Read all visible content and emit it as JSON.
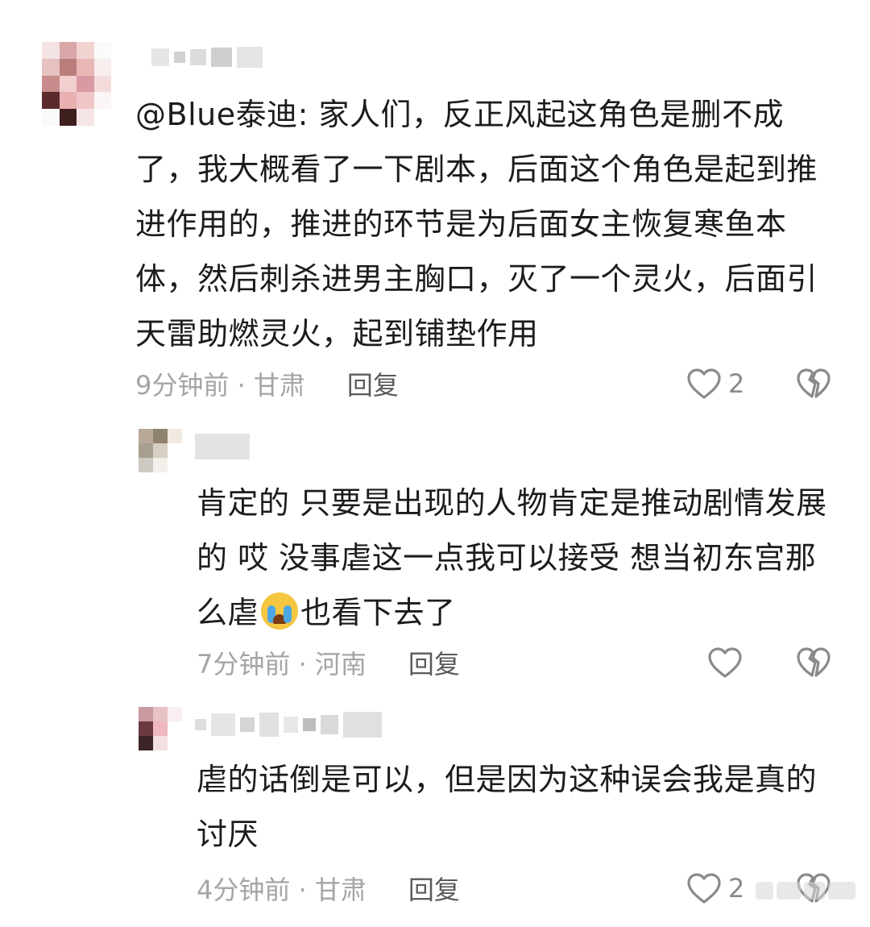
{
  "comments": [
    {
      "text": "@Blue泰迪: 家人们，反正风起这角色是删不成了，我大概看了一下剧本，后面这个角色是起到推进作用的，推进的环节是为后面女主恢复寒鱼本体，然后刺杀进男主胸口，灭了一个灵火，后面引天雷助燃灵火，起到铺垫作用",
      "time_location": "9分钟前 · 甘肃",
      "reply_label": "回复",
      "like_count": "2"
    },
    {
      "text_before_emoji": "肯定的 只要是出现的人物肯定是推动剧情发展的 哎 没事虐这一点我可以接受 想当初东宫那么虐",
      "emoji": "loudly-crying-face-emoji",
      "text_after_emoji": "也看下去了",
      "time_location": "7分钟前 · 河南",
      "reply_label": "回复",
      "like_count": ""
    },
    {
      "text": "虐的话倒是可以，但是因为这种误会我是真的讨厌",
      "time_location": "4分钟前 · 甘肃",
      "reply_label": "回复",
      "like_count": "2"
    }
  ],
  "icons": {
    "like": "heart-outline-icon",
    "dislike": "broken-heart-icon"
  },
  "colors": {
    "text": "#1c1c1c",
    "meta": "#a5a5a5",
    "reply": "#5a5a5a",
    "icon": "#8a8a8a"
  }
}
